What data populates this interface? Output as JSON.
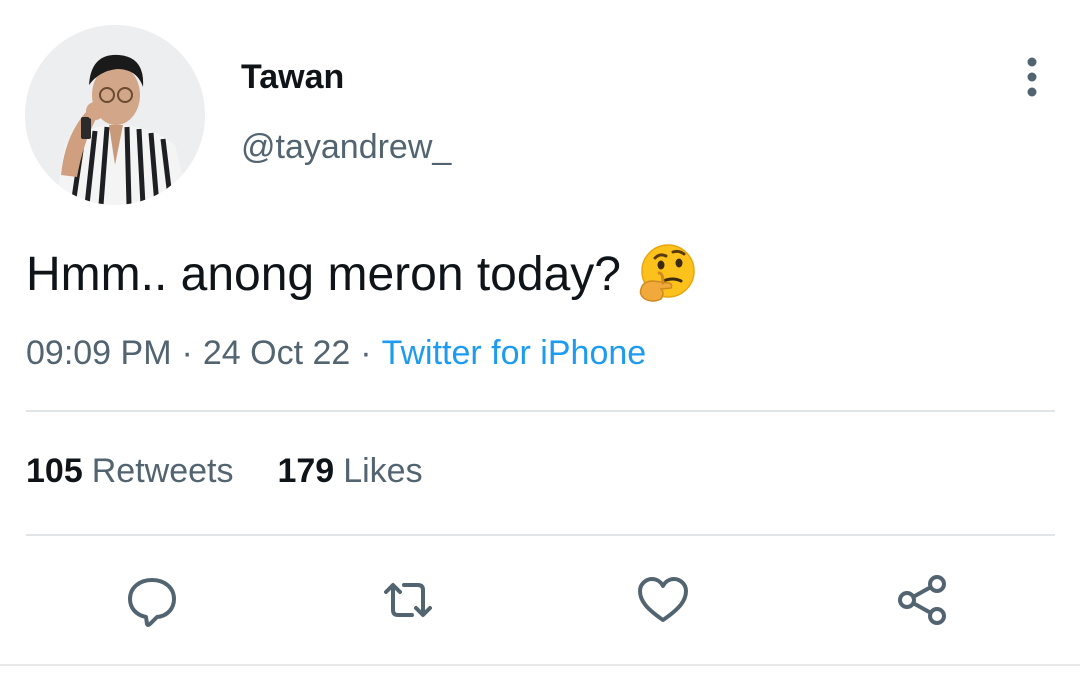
{
  "author": {
    "display_name": "Tawan",
    "handle": "@tayandrew_",
    "avatar_icon": "profile-photo"
  },
  "tweet": {
    "text": "Hmm.. anong meron today?",
    "emoji": "thinking-face-emoji"
  },
  "meta": {
    "time": "09:09 PM",
    "date": "24 Oct 22",
    "separator": "·",
    "source": "Twitter for iPhone"
  },
  "stats": {
    "retweets_count": "105",
    "retweets_label": "Retweets",
    "likes_count": "179",
    "likes_label": "Likes"
  },
  "actions": {
    "reply_icon": "reply-icon",
    "retweet_icon": "retweet-icon",
    "like_icon": "heart-icon",
    "share_icon": "share-icon"
  },
  "colors": {
    "text": "#0f1419",
    "secondary": "#536471",
    "link": "#1d9bf0",
    "divider": "#e1e5e8"
  }
}
